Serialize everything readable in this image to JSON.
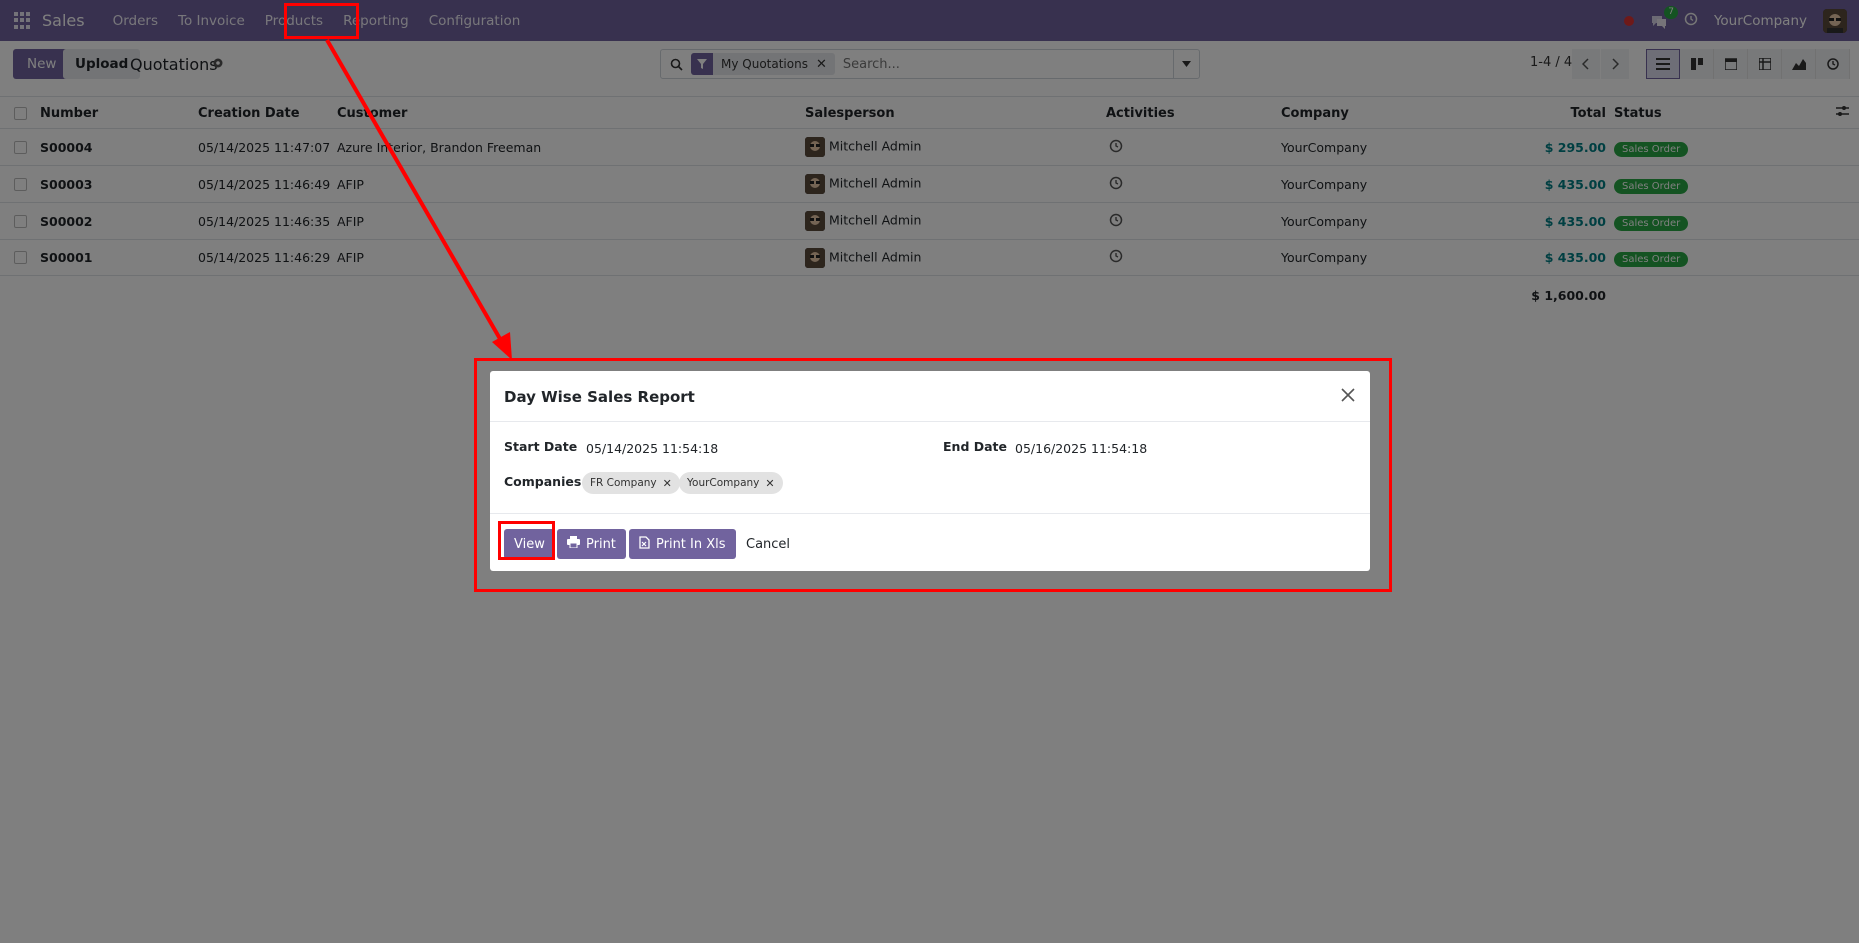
{
  "navbar": {
    "brand": "Sales",
    "menu": [
      "Orders",
      "To Invoice",
      "Products",
      "Reporting",
      "Configuration"
    ],
    "chat_count": "7",
    "company": "YourCompany"
  },
  "control": {
    "new_label": "New",
    "upload_label": "Upload",
    "title": "Quotations",
    "facet": "My Quotations",
    "search_placeholder": "Search...",
    "pager": "1-4 / 4"
  },
  "table": {
    "headers": {
      "number": "Number",
      "creation_date": "Creation Date",
      "customer": "Customer",
      "salesperson": "Salesperson",
      "activities": "Activities",
      "company": "Company",
      "total": "Total",
      "status": "Status"
    },
    "rows": [
      {
        "number": "S00004",
        "date": "05/14/2025 11:47:07",
        "customer": "Azure Interior, Brandon Freeman",
        "salesperson": "Mitchell Admin",
        "company": "YourCompany",
        "total": "$ 295.00",
        "status": "Sales Order"
      },
      {
        "number": "S00003",
        "date": "05/14/2025 11:46:49",
        "customer": "AFIP",
        "salesperson": "Mitchell Admin",
        "company": "YourCompany",
        "total": "$ 435.00",
        "status": "Sales Order"
      },
      {
        "number": "S00002",
        "date": "05/14/2025 11:46:35",
        "customer": "AFIP",
        "salesperson": "Mitchell Admin",
        "company": "YourCompany",
        "total": "$ 435.00",
        "status": "Sales Order"
      },
      {
        "number": "S00001",
        "date": "05/14/2025 11:46:29",
        "customer": "AFIP",
        "salesperson": "Mitchell Admin",
        "company": "YourCompany",
        "total": "$ 435.00",
        "status": "Sales Order"
      }
    ],
    "grand_total": "$ 1,600.00"
  },
  "dialog": {
    "title": "Day Wise Sales Report",
    "start_label": "Start Date",
    "start_value": "05/14/2025 11:54:18",
    "end_label": "End Date",
    "end_value": "05/16/2025 11:54:18",
    "companies_label": "Companies",
    "companies": [
      "FR Company",
      "YourCompany"
    ],
    "buttons": {
      "view": "View",
      "print": "Print",
      "print_xls": "Print In Xls",
      "cancel": "Cancel"
    }
  },
  "colors": {
    "brand": "#71639e",
    "status": "#28a745",
    "total": "#017e84",
    "annotation": "#ff0000"
  }
}
